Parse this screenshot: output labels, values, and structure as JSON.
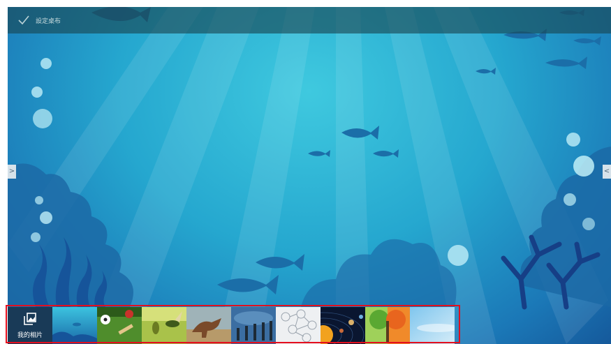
{
  "topbar": {
    "action_label": "設定桌布",
    "icon": "checkmark-icon"
  },
  "nav": {
    "prev_symbol": ">",
    "next_symbol": "<"
  },
  "gallery": {
    "my_photos_label": "我的相片",
    "my_photos_icon": "photo-album-icon",
    "thumbnails": [
      "underwater-ocean-wallpaper",
      "sports-wallpaper",
      "insect-evolution-wallpaper",
      "dinosaur-wallpaper",
      "human-evolution-wallpaper",
      "molecule-network-wallpaper",
      "solar-system-wallpaper",
      "tree-seasons-wallpaper",
      "sky-gradient-wallpaper"
    ]
  },
  "colors": {
    "highlight": "#e40e1d",
    "topbar": "#184650",
    "ocean": "#25a7cf"
  }
}
